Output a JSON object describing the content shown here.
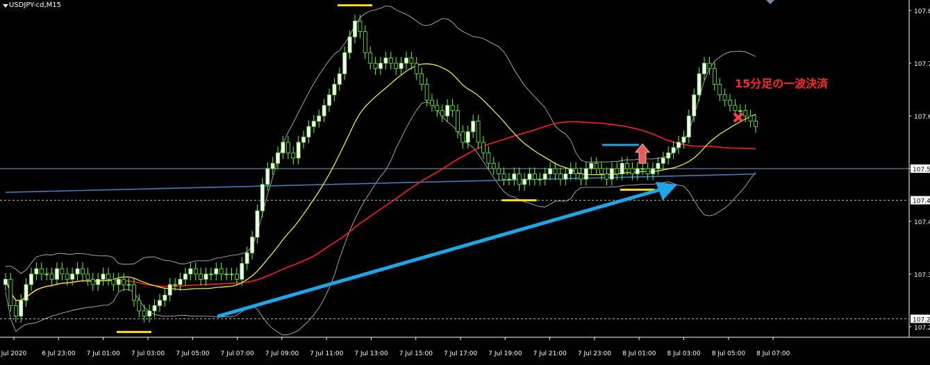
{
  "chart": {
    "symbol": "USDJPY-cd,M15",
    "annotation": "15分足の一波決済"
  },
  "chart_data": {
    "type": "candlestick",
    "ylim": [
      107.18,
      107.82
    ],
    "price_labels": [
      "107.8",
      "107.7",
      "107.6",
      "107.5",
      "107.4",
      "107.3",
      "107.2"
    ],
    "current_price_label": "107.5",
    "levels_dashed": [
      {
        "label": "107.4",
        "value": 107.44
      },
      {
        "label": "107.2",
        "value": 107.215
      }
    ],
    "level_solid": {
      "value": 107.5
    },
    "time_labels": [
      "6 Jul 2020",
      "6 Jul 23:00",
      "7 Jul 01:00",
      "7 Jul 03:00",
      "7 Jul 05:00",
      "7 Jul 07:00",
      "7 Jul 09:00",
      "7 Jul 11:00",
      "7 Jul 13:00",
      "7 Jul 15:00",
      "7 Jul 17:00",
      "7 Jul 19:00",
      "7 Jul 21:00",
      "7 Jul 23:00",
      "8 Jul 01:00",
      "8 Jul 03:00",
      "8 Jul 05:00",
      "8 Jul 07:00"
    ],
    "candles_close": [
      107.29,
      107.24,
      107.22,
      107.25,
      107.28,
      107.3,
      107.31,
      107.3,
      107.3,
      107.29,
      107.31,
      107.3,
      107.29,
      107.3,
      107.31,
      107.3,
      107.29,
      107.28,
      107.29,
      107.3,
      107.29,
      107.28,
      107.29,
      107.28,
      107.28,
      107.25,
      107.23,
      107.22,
      107.23,
      107.24,
      107.25,
      107.26,
      107.28,
      107.28,
      107.29,
      107.3,
      107.31,
      107.3,
      107.29,
      107.3,
      107.3,
      107.31,
      107.3,
      107.3,
      107.3,
      107.29,
      107.32,
      107.34,
      107.37,
      107.42,
      107.47,
      107.5,
      107.51,
      107.53,
      107.55,
      107.53,
      107.52,
      107.55,
      107.56,
      107.58,
      107.59,
      107.6,
      107.62,
      107.64,
      107.66,
      107.68,
      107.72,
      107.75,
      107.78,
      107.76,
      107.72,
      107.7,
      107.69,
      107.7,
      107.71,
      107.7,
      107.69,
      107.7,
      107.71,
      107.7,
      107.68,
      107.66,
      107.63,
      107.62,
      107.61,
      107.6,
      107.62,
      107.61,
      107.57,
      107.55,
      107.57,
      107.59,
      107.55,
      107.53,
      107.51,
      107.5,
      107.49,
      107.48,
      107.48,
      107.49,
      107.47,
      107.48,
      107.49,
      107.48,
      107.48,
      107.49,
      107.5,
      107.49,
      107.48,
      107.49,
      107.5,
      107.49,
      107.48,
      107.5,
      107.51,
      107.5,
      107.49,
      107.48,
      107.5,
      107.49,
      107.51,
      107.5,
      107.49,
      107.5,
      107.5,
      107.49,
      107.5,
      107.51,
      107.52,
      107.53,
      107.54,
      107.55,
      107.56,
      107.6,
      107.64,
      107.68,
      107.7,
      107.69,
      107.66,
      107.64,
      107.63,
      107.62,
      107.61,
      107.61,
      107.6,
      107.59,
      107.58
    ],
    "bollinger": {
      "color": "#c8c8c8"
    },
    "ma_fast": {
      "color": "#ffff33"
    },
    "ma_mid": {
      "color": "#ff2020"
    },
    "ma_slow": {
      "color": "#3f7fbf"
    },
    "markers": {
      "yellow_highs_lows": [
        {
          "label": "low",
          "time_index": 25
        },
        {
          "label": "high",
          "time_index": 68
        },
        {
          "label": "low",
          "time_index": 100
        },
        {
          "label": "low",
          "time_index": 123
        }
      ],
      "blue_level": {
        "value": 107.545
      },
      "arrow_up_color": "#e0605a",
      "exit_marker_color": "#ff4040",
      "trend_arrow_color": "#1ca8e8"
    }
  }
}
